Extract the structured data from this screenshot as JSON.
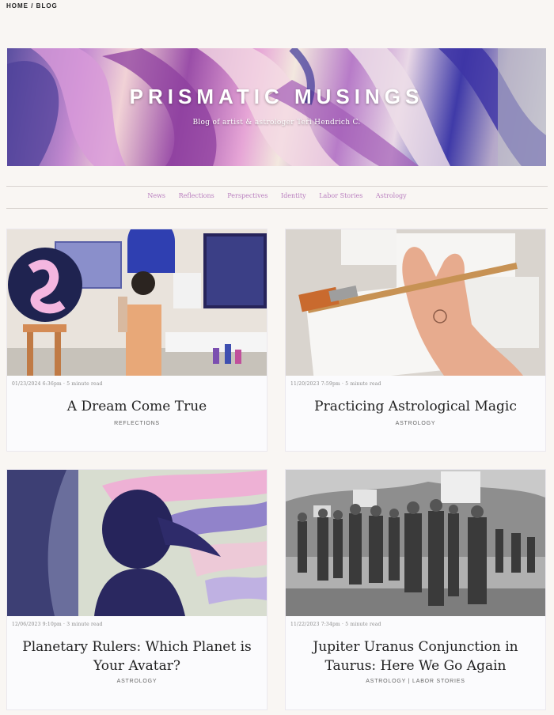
{
  "breadcrumb": {
    "home": "HOME",
    "sep": " / ",
    "current": "BLOG"
  },
  "hero": {
    "title": "PRISMATIC MUSINGS",
    "subtitle": "Blog of artist & astrologer Teri Hendrich C."
  },
  "nav": {
    "items": [
      {
        "label": "News"
      },
      {
        "label": "Reflections"
      },
      {
        "label": "Perspectives"
      },
      {
        "label": "Identity"
      },
      {
        "label": "Labor Stories"
      },
      {
        "label": "Astrology"
      }
    ]
  },
  "posts": [
    {
      "meta": "01/23/2024 6:36pm  ·  5 minute read",
      "title": "A Dream Come True",
      "category": "REFLECTIONS",
      "image": "artist-studio-photo"
    },
    {
      "meta": "11/20/2023 7:59pm  ·  5 minute read",
      "title": "Practicing Astrological Magic",
      "category": "ASTROLOGY",
      "image": "paintbrush-hand-photo"
    },
    {
      "meta": "12/06/2023 9:10pm  ·  3 minute read",
      "title": "Planetary Rulers: Which Planet is Your Avatar?",
      "category": "ASTROLOGY",
      "image": "woman-wind-illustration"
    },
    {
      "meta": "11/22/2023 7:34pm  ·  5 minute read",
      "title": "Jupiter Uranus Conjunction in Taurus: Here We Go Again",
      "category": "ASTROLOGY | LABOR STORIES",
      "image": "strike-protest-photo"
    }
  ],
  "colors": {
    "background": "#f9f6f3",
    "nav_link": "#b97fbf",
    "title": "#222222"
  }
}
